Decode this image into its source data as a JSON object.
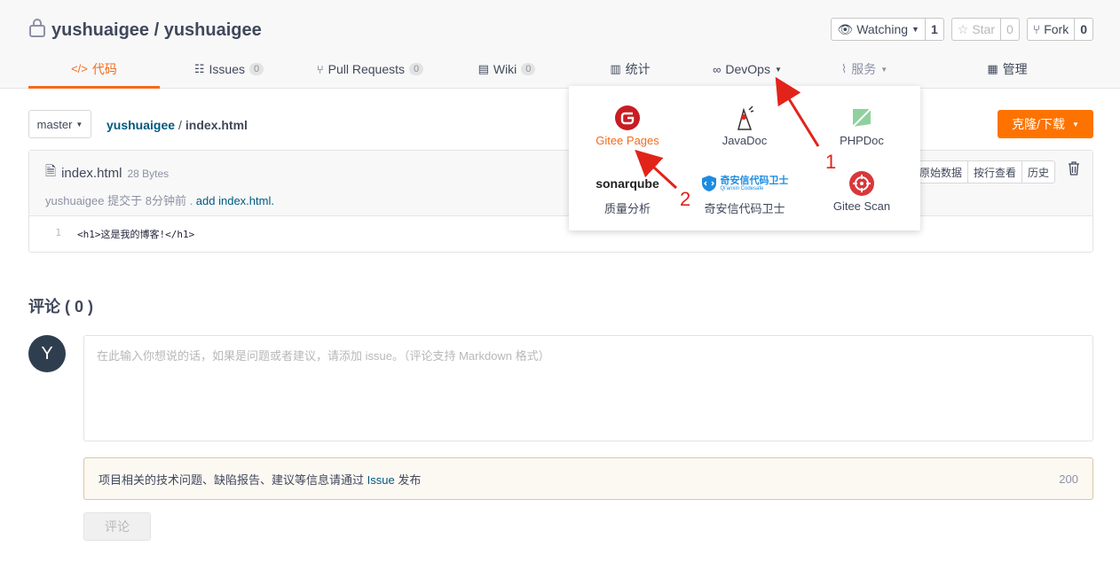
{
  "repo": {
    "title": "yushuaigee / yushuaigee"
  },
  "actions": [
    {
      "name": "watch",
      "label": "Watching",
      "count": "1",
      "caret": true,
      "disabled": false
    },
    {
      "name": "star",
      "label": "Star",
      "count": "0",
      "caret": false,
      "disabled": true
    },
    {
      "name": "fork",
      "label": "Fork",
      "count": "0",
      "caret": false,
      "disabled": false
    }
  ],
  "tabs": [
    {
      "key": "code",
      "icon": "</>",
      "label": "代码",
      "badge": "",
      "active": true
    },
    {
      "key": "issues",
      "icon": "☷",
      "label": "Issues",
      "badge": "0"
    },
    {
      "key": "pulls",
      "icon": "⑂",
      "label": "Pull Requests",
      "badge": "0"
    },
    {
      "key": "wiki",
      "icon": "▤",
      "label": "Wiki",
      "badge": "0"
    },
    {
      "key": "stats",
      "icon": "▥",
      "label": "统计",
      "badge": ""
    },
    {
      "key": "devops",
      "icon": "∞",
      "label": "DevOps",
      "badge": "",
      "caret": true
    },
    {
      "key": "services",
      "icon": "⌇",
      "label": "服务",
      "badge": "",
      "caret": true,
      "muted": true
    },
    {
      "key": "manage",
      "icon": "▦",
      "label": "管理",
      "badge": ""
    }
  ],
  "branch": {
    "label": "master"
  },
  "breadcrumb": {
    "owner": "yushuaigee",
    "sep": "/",
    "file": "index.html"
  },
  "clone": {
    "label": "克隆/下载"
  },
  "file": {
    "name": "index.html",
    "size": "28 Bytes",
    "commit_prefix": "yushuaigee 提交于 8分钟前 . ",
    "commit_msg": "add index.html.",
    "buttons": [
      "原始数据",
      "按行查看",
      "历史"
    ],
    "line_no": "1",
    "code": "<h1>这是我的博客!</h1>"
  },
  "comments": {
    "title": "评论 ( 0 )",
    "avatar_letter": "Y",
    "placeholder": "在此输入你想说的话，如果是问题或者建议，请添加 issue。（评论支持 Markdown 格式）",
    "notice_prefix": "项目相关的技术问题、缺陷报告、建议等信息请通过 ",
    "notice_link": "Issue",
    "notice_suffix": " 发布",
    "notice_count": "200",
    "submit": "评论"
  },
  "devops_menu": {
    "items": [
      {
        "key": "gitee-pages",
        "label": "Gitee Pages",
        "highlight": true
      },
      {
        "key": "javadoc",
        "label": "JavaDoc"
      },
      {
        "key": "phpdoc",
        "label": "PHPDoc"
      },
      {
        "key": "sonarqube",
        "label": "质量分析",
        "logo_text": "sonarqube"
      },
      {
        "key": "qianxin",
        "label": "奇安信代码卫士",
        "logo_text": "奇安信代码卫士",
        "logo_sub": "Qi'anxin Codesafe"
      },
      {
        "key": "gitee-scan",
        "label": "Gitee Scan"
      }
    ]
  },
  "annotations": {
    "mark1": "1",
    "mark2": "2"
  },
  "colors": {
    "accent": "#f26b1d",
    "clone_bg": "#fe7300",
    "link": "#005980",
    "annotation": "#e2231a"
  }
}
